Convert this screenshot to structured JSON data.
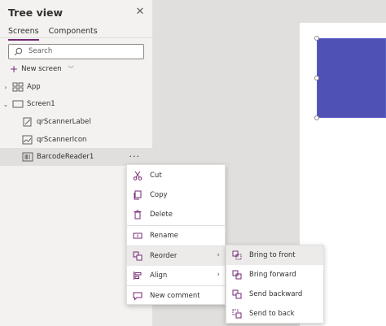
{
  "panel": {
    "title": "Tree view",
    "tabs": [
      {
        "label": "Screens",
        "active": true
      },
      {
        "label": "Components",
        "active": false
      }
    ],
    "search": {
      "placeholder": "Search"
    },
    "new_screen": "New screen"
  },
  "tree": [
    {
      "label": "App",
      "icon": "app-icon"
    },
    {
      "label": "Screen1",
      "icon": "screen-icon"
    },
    {
      "label": "qrScannerLabel",
      "icon": "label-icon"
    },
    {
      "label": "qrScannerIcon",
      "icon": "image-icon"
    },
    {
      "label": "BarcodeReader1",
      "icon": "barcode-icon",
      "more": "···"
    }
  ],
  "context_menu": [
    {
      "label": "Cut",
      "icon": "scissors-icon"
    },
    {
      "label": "Copy",
      "icon": "copy-icon"
    },
    {
      "label": "Delete",
      "icon": "trash-icon"
    },
    {
      "label": "Rename",
      "icon": "rename-icon"
    },
    {
      "label": "Reorder",
      "icon": "reorder-icon",
      "has_submenu": true
    },
    {
      "label": "Align",
      "icon": "align-icon",
      "has_submenu": true
    },
    {
      "label": "New comment",
      "icon": "comment-icon"
    }
  ],
  "reorder_submenu": [
    {
      "label": "Bring to front",
      "icon": "bring-to-front-icon"
    },
    {
      "label": "Bring forward",
      "icon": "bring-forward-icon"
    },
    {
      "label": "Send backward",
      "icon": "send-backward-icon"
    },
    {
      "label": "Send to back",
      "icon": "send-to-back-icon"
    }
  ],
  "colors": {
    "accent": "#742774",
    "selected_shape": "#4f52b2"
  }
}
